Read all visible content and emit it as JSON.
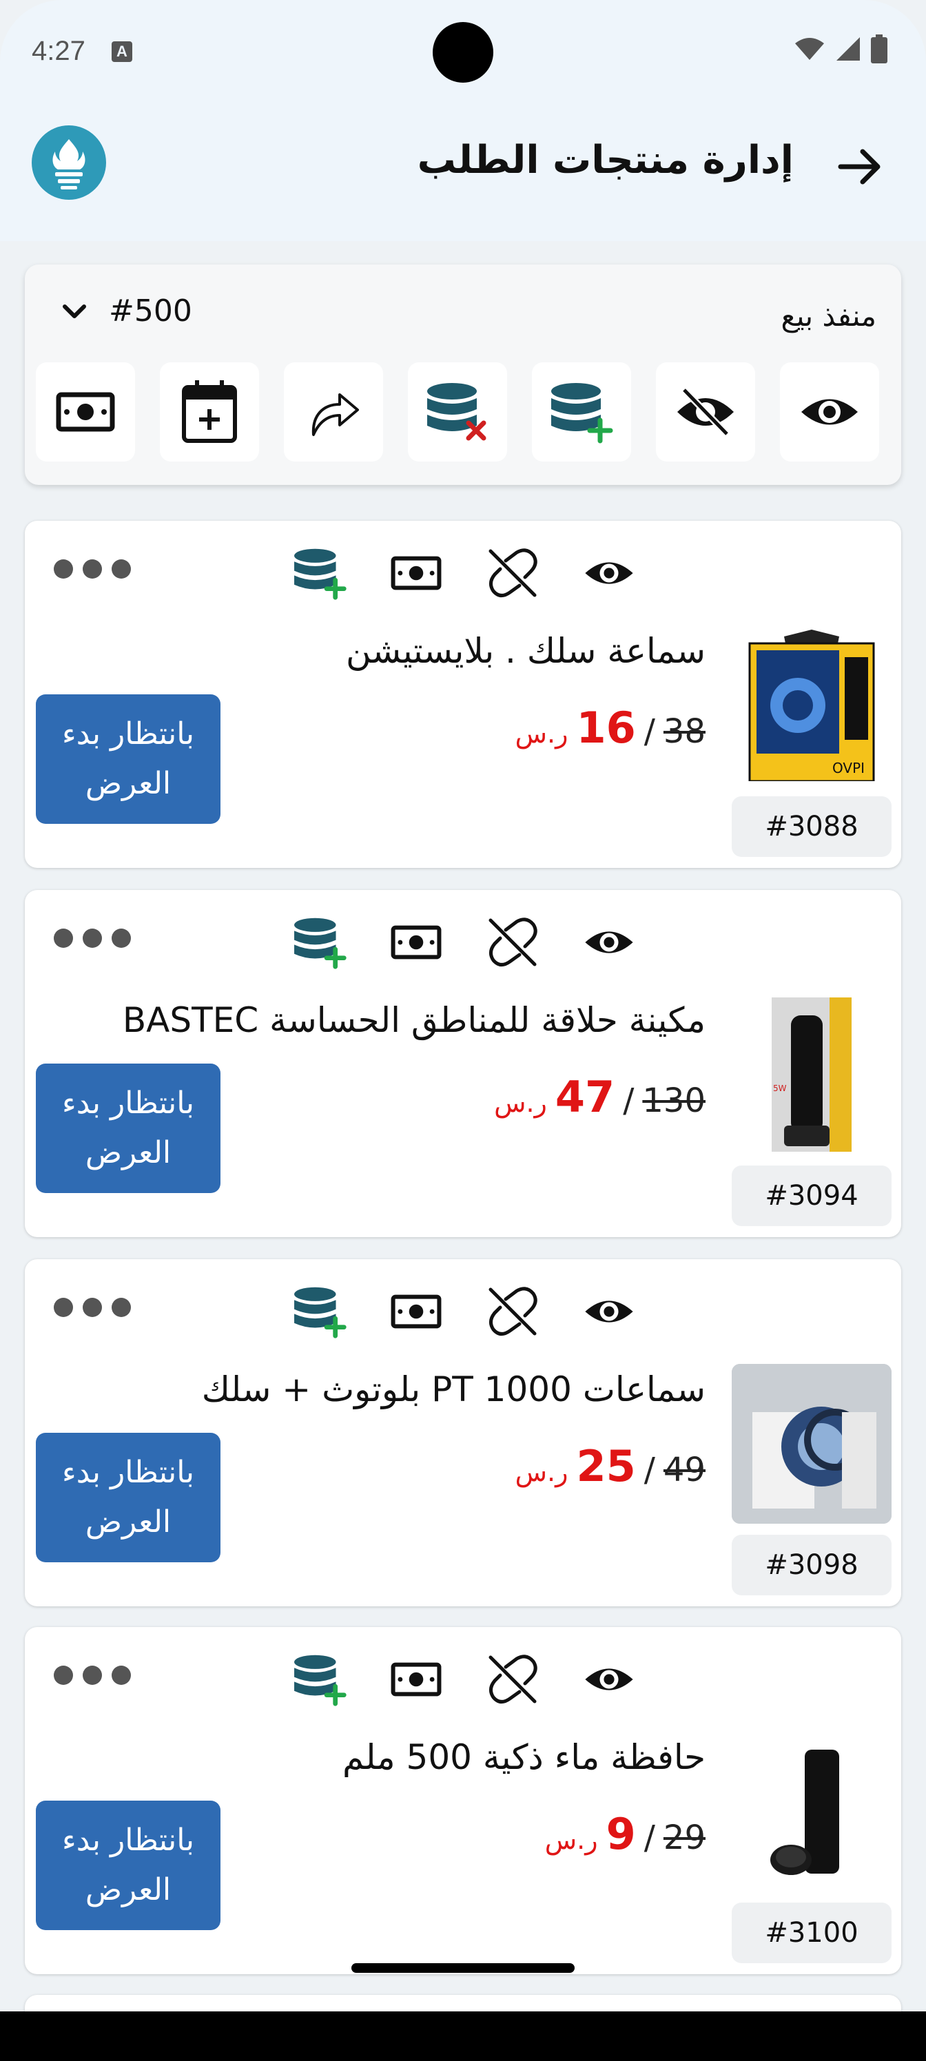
{
  "status_bar": {
    "time": "4:27",
    "notif_letter": "A"
  },
  "header": {
    "title": "إدارة منتجات الطلب"
  },
  "filter": {
    "outlet_label": "منفذ بيع",
    "order_number": "#500",
    "tools": [
      {
        "icon": "eye-icon"
      },
      {
        "icon": "eye-off-icon"
      },
      {
        "icon": "database-add-icon"
      },
      {
        "icon": "database-remove-icon"
      },
      {
        "icon": "share-arrow-icon"
      },
      {
        "icon": "calendar-add-icon"
      },
      {
        "icon": "cash-icon"
      }
    ]
  },
  "products": [
    {
      "name": "سماعة سلك . بلايستيشن",
      "old_price": "38",
      "separator": "/",
      "new_price": "16",
      "currency": "ر.س",
      "status": "بانتظار بدء العرض",
      "id": "#3088",
      "thumb": "headset-box"
    },
    {
      "name": "مكينة حلاقة للمناطق الحساسة BASTEC",
      "old_price": "130",
      "separator": "/",
      "new_price": "47",
      "currency": "ر.س",
      "status": "بانتظار بدء العرض",
      "id": "#3094",
      "thumb": "trimmer-box"
    },
    {
      "name": "سماعات PT 1000  بلوتوث + سلك",
      "old_price": "49",
      "separator": "/",
      "new_price": "25",
      "currency": "ر.س",
      "status": "بانتظار بدء العرض",
      "id": "#3098",
      "thumb": "headphones"
    },
    {
      "name": "حافظة ماء ذكية 500 ملم",
      "old_price": "29",
      "separator": "/",
      "new_price": "9",
      "currency": "ر.س",
      "status": "بانتظار بدء العرض",
      "id": "#3100",
      "thumb": "bottle"
    }
  ],
  "colors": {
    "accent": "#2f6bb3",
    "price_red": "#e01515",
    "db_icon": "#1f5a6b",
    "plus_green": "#22a84a",
    "remove_red": "#d02020"
  }
}
